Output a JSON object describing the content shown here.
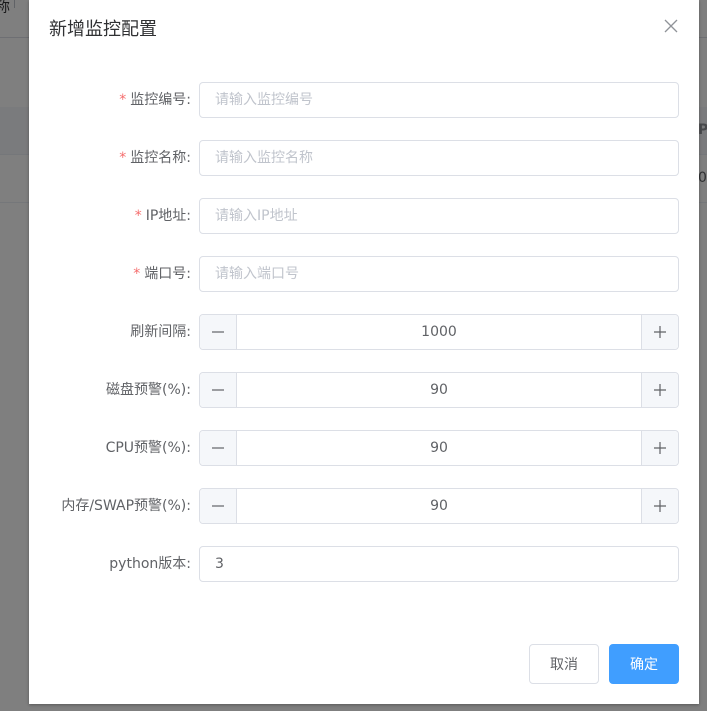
{
  "background": {
    "topbar_text": "称",
    "table_head_text": "P",
    "table_row_text": "0"
  },
  "dialog": {
    "title": "新增监控配置",
    "close_icon": "close-icon"
  },
  "form": {
    "monitor_code": {
      "label": "监控编号:",
      "required": true,
      "placeholder": "请输入监控编号",
      "value": ""
    },
    "monitor_name": {
      "label": "监控名称:",
      "required": true,
      "placeholder": "请输入监控名称",
      "value": ""
    },
    "ip_address": {
      "label": "IP地址:",
      "required": true,
      "placeholder": "请输入IP地址",
      "value": ""
    },
    "port": {
      "label": "端口号:",
      "required": true,
      "placeholder": "请输入端口号",
      "value": ""
    },
    "refresh_interval": {
      "label": "刷新间隔:",
      "value": "1000"
    },
    "disk_warning": {
      "label": "磁盘预警(%):",
      "value": "90"
    },
    "cpu_warning": {
      "label": "CPU预警(%):",
      "value": "90"
    },
    "memory_warning": {
      "label": "内存/SWAP预警(%):",
      "value": "90"
    },
    "python_version": {
      "label": "python版本:",
      "value": "3"
    }
  },
  "required_marker": "*",
  "footer": {
    "cancel_label": "取消",
    "confirm_label": "确定"
  },
  "colors": {
    "primary": "#409eff",
    "required": "#f56c6c",
    "label": "#606266",
    "placeholder": "#c0c4cc",
    "border": "#dcdfe6"
  }
}
